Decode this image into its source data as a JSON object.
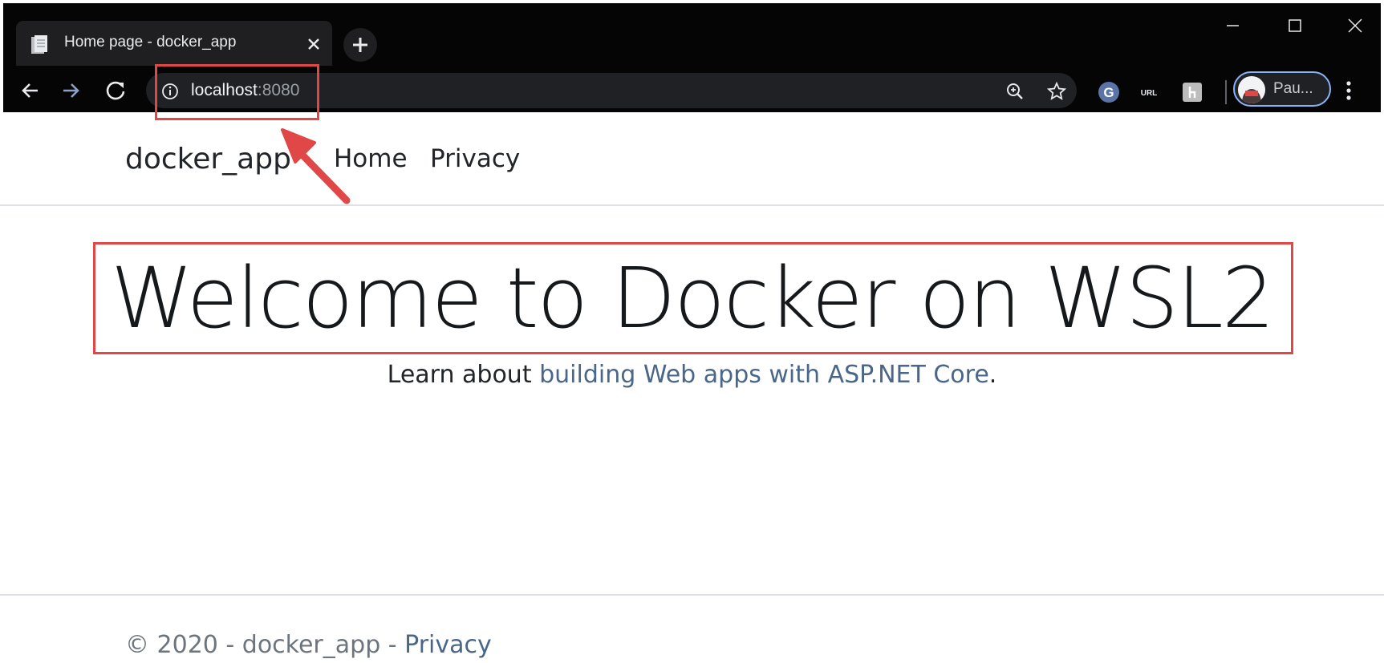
{
  "browser": {
    "tab_title": "Home page - docker_app",
    "url_host": "localhost",
    "url_port": ":8080",
    "profile_name": "Pau...",
    "extensions": [
      "grammarly-icon",
      "url-shortener-icon",
      "extension-icon"
    ]
  },
  "site": {
    "brand": "docker_app",
    "nav": [
      "Home",
      "Privacy"
    ]
  },
  "hero": {
    "title": "Welcome to Docker on WSL2",
    "learn_prefix": "Learn about ",
    "learn_link": "building Web apps with ASP.NET Core",
    "learn_suffix": "."
  },
  "footer": {
    "text": "© 2020 - docker_app - ",
    "link": "Privacy"
  },
  "annotations": {
    "box_color": "#e04848",
    "arrow_color": "#e04848"
  },
  "colors": {
    "link": "#4a6688",
    "text": "#212529",
    "chrome_bg": "#050505"
  }
}
